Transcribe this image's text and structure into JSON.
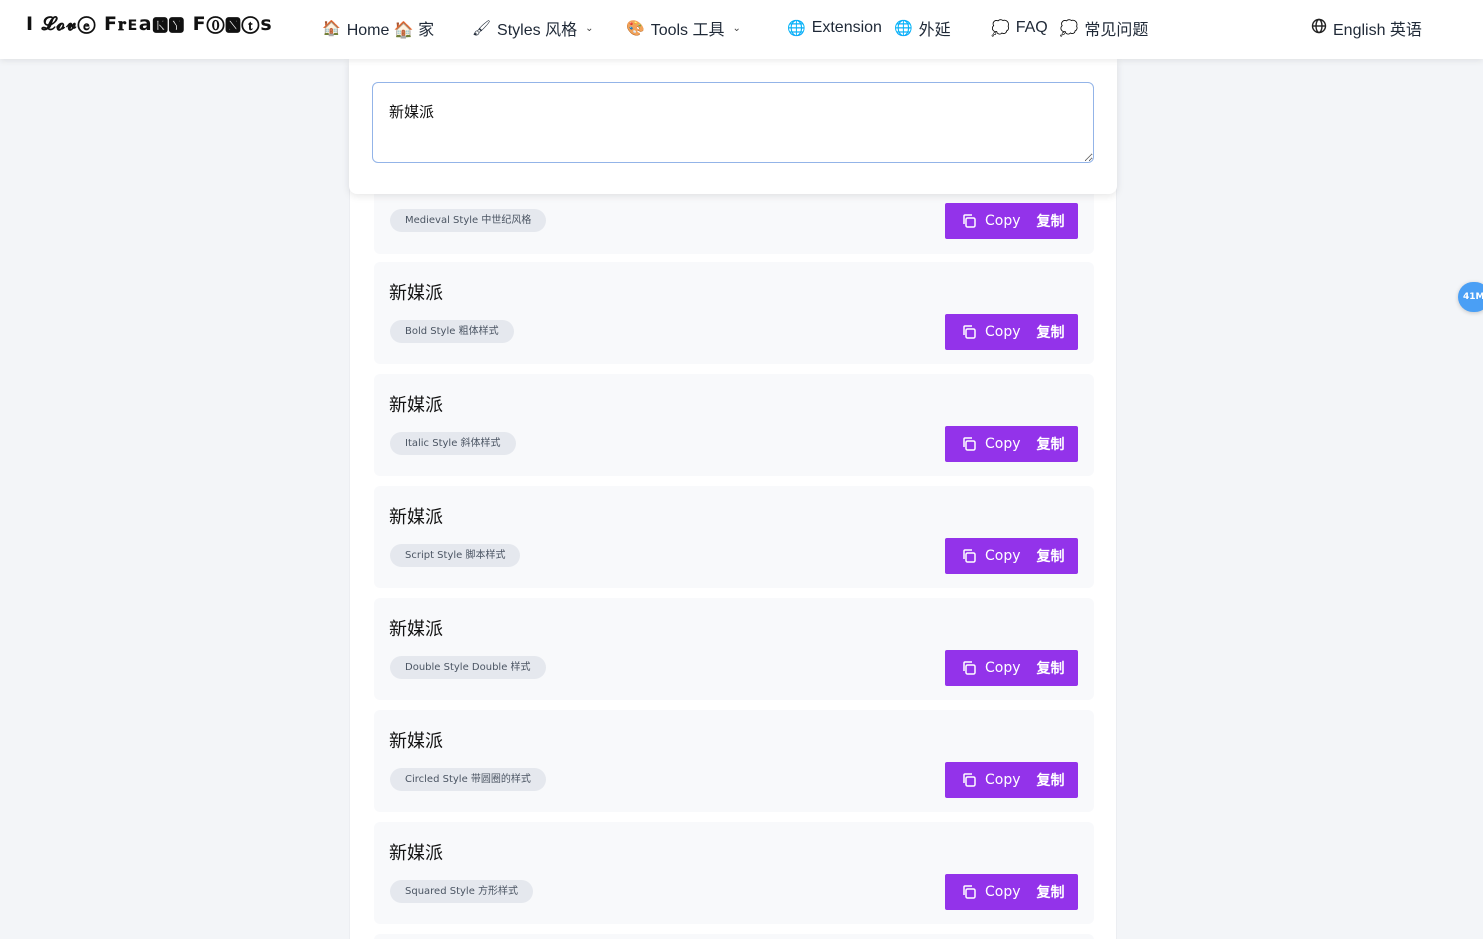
{
  "nav": {
    "logo": "I 𝓛𝓸𝓿ⓔ F𝐫ᴇa🅺🆈 F⓪🅽ⓣs",
    "home": "Home 🏠 家",
    "styles": "Styles 风格",
    "tools": "Tools 工具",
    "extension": "Extension",
    "extension_cn": "外延",
    "faq": "FAQ",
    "faq_cn": "常见问题",
    "language": "English 英语"
  },
  "input": {
    "value": "新媒派"
  },
  "copy_label": "Copy",
  "copy_label_cn": "复制",
  "results": [
    {
      "sample": "",
      "style": "Medieval Style 中世纪风格"
    },
    {
      "sample": "新媒派",
      "style": "Bold Style 粗体样式"
    },
    {
      "sample": "新媒派",
      "style": "Italic Style 斜体样式"
    },
    {
      "sample": "新媒派",
      "style": "Script Style 脚本样式"
    },
    {
      "sample": "新媒派",
      "style": "Double Style Double 样式"
    },
    {
      "sample": "新媒派",
      "style": "Circled Style 带圆圈的样式"
    },
    {
      "sample": "新媒派",
      "style": "Squared Style 方形样式"
    }
  ],
  "side_badge": "41M",
  "colors": {
    "accent": "#9333ea",
    "badge": "#4a9ff5",
    "background": "#f3f5f8"
  }
}
